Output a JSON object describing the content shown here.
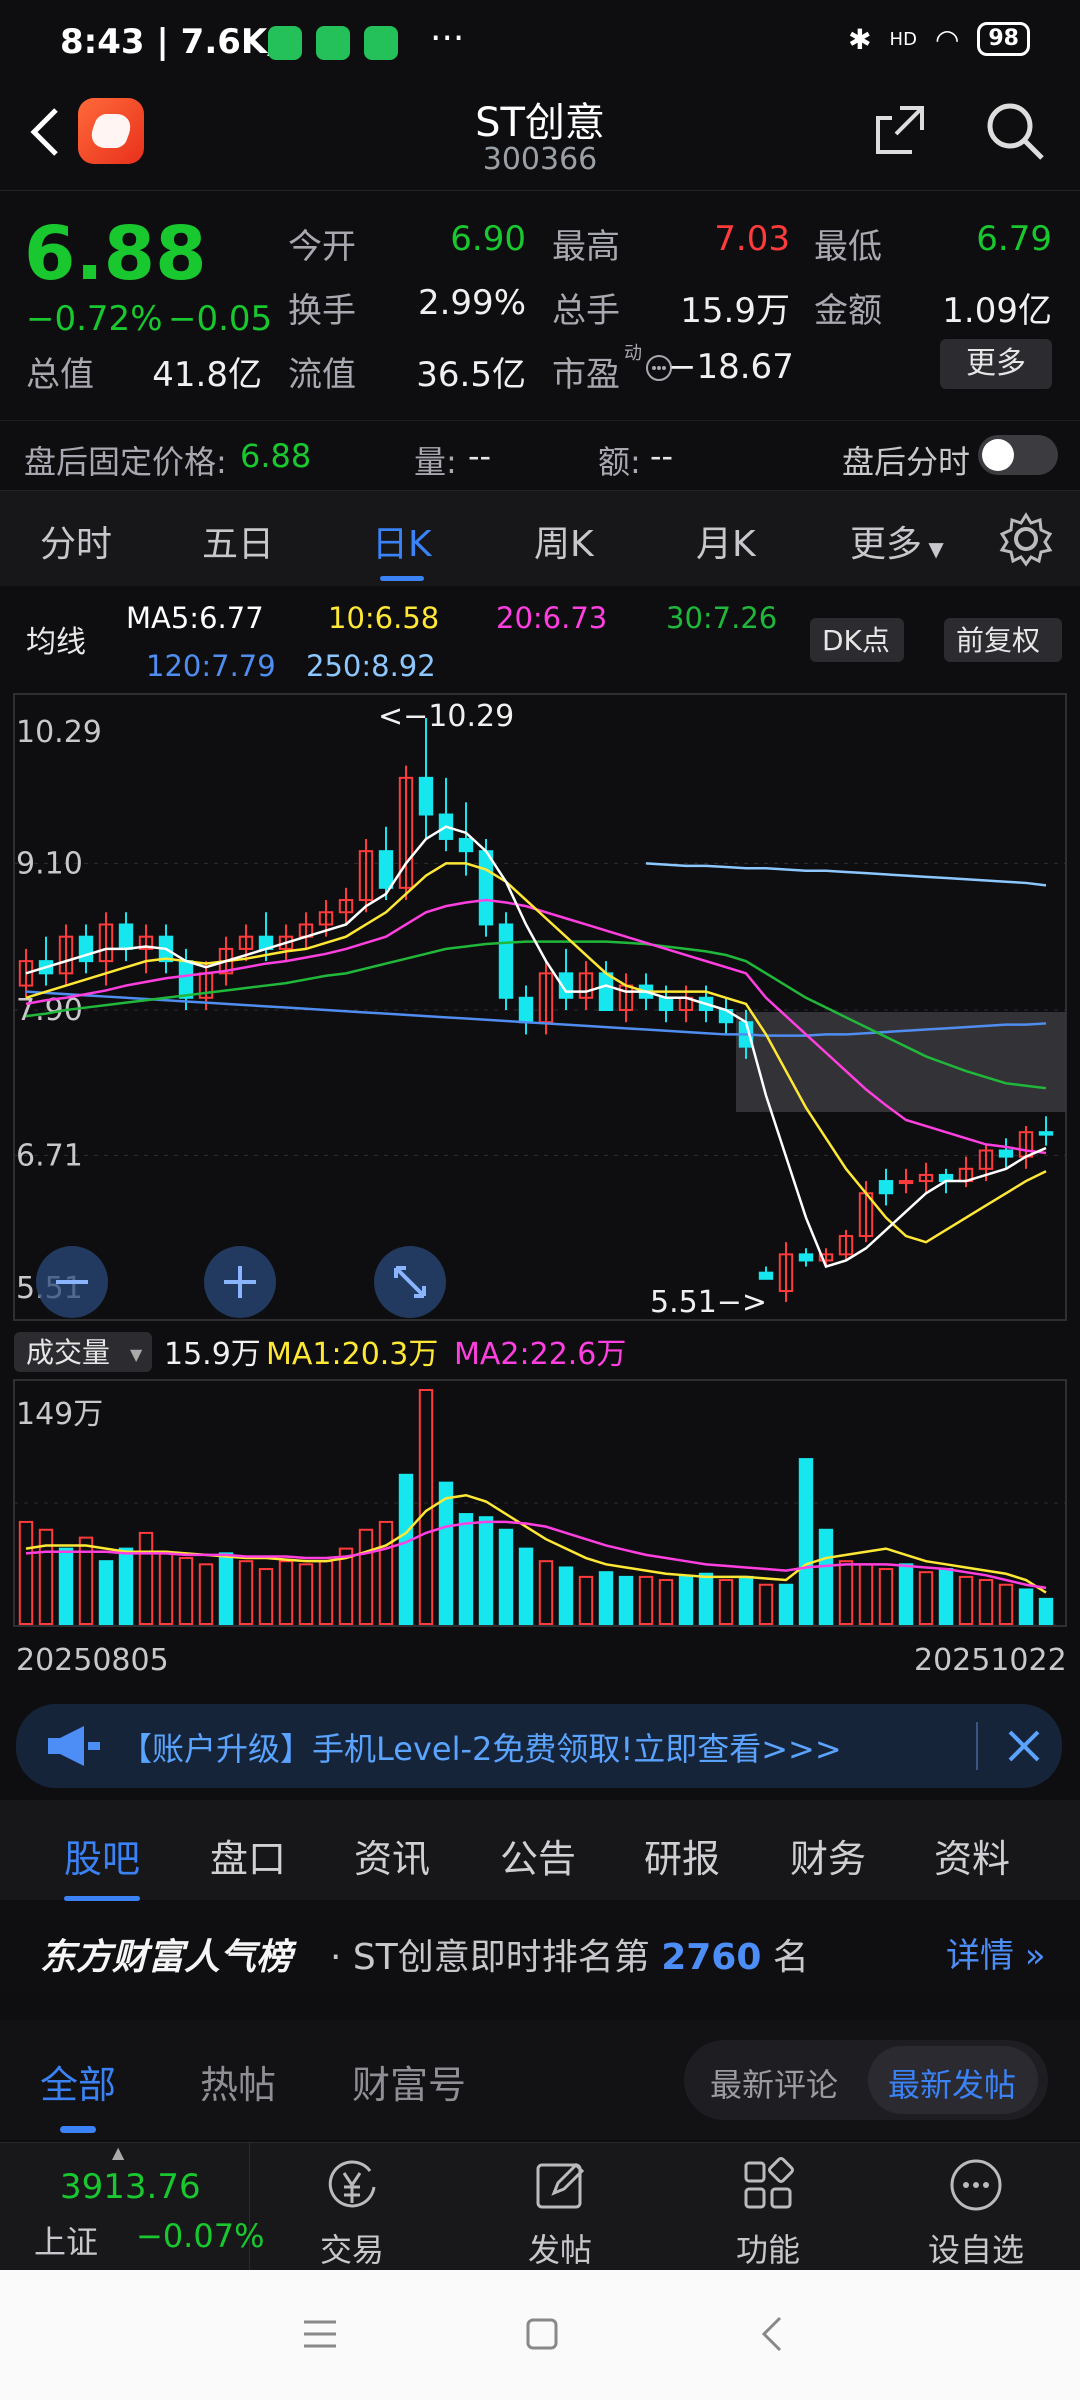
{
  "status": {
    "time": "8:43 | 7.6K/s",
    "more": "···",
    "battery": "98",
    "hd": "HD"
  },
  "header": {
    "title": "ST创意",
    "code": "300366"
  },
  "quote": {
    "price": "6.88",
    "change_pct": "−0.72%",
    "change": "−0.05",
    "fields": [
      {
        "label": "今开",
        "value": "6.90",
        "color": "g"
      },
      {
        "label": "最高",
        "value": "7.03",
        "color": "r"
      },
      {
        "label": "最低",
        "value": "6.79",
        "color": "g"
      },
      {
        "label": "换手",
        "value": "2.99%",
        "color": "w"
      },
      {
        "label": "总手",
        "value": "15.9万",
        "color": "w"
      },
      {
        "label": "金额",
        "value": "1.09亿",
        "color": "w"
      },
      {
        "label": "总值",
        "value": "41.8亿",
        "color": "w"
      },
      {
        "label": "流值",
        "value": "36.5亿",
        "color": "w"
      },
      {
        "label": "市盈",
        "value": "−18.67",
        "color": "w"
      }
    ],
    "pe_super": "动",
    "more_button": "更多"
  },
  "afterhours": {
    "fixed_label": "盘后固定价格:",
    "fixed_value": "6.88",
    "vol_label": "量:",
    "vol_value": "--",
    "amt_label": "额:",
    "amt_value": "--",
    "toggle_label": "盘后分时",
    "toggle_on": false
  },
  "ktabs": [
    "分时",
    "五日",
    "日K",
    "周K",
    "月K",
    "更多"
  ],
  "ktab_active": 2,
  "ma": {
    "title": "均线",
    "items": [
      {
        "text": "MA5:6.77",
        "color": "#ffffff"
      },
      {
        "text": "10:6.58",
        "color": "#ffe835"
      },
      {
        "text": "20:6.73",
        "color": "#ff3fe0"
      },
      {
        "text": "30:7.26",
        "color": "#20b83a"
      },
      {
        "text": "120:7.79",
        "color": "#4f8ef0"
      },
      {
        "text": "250:8.92",
        "color": "#8cc8ff"
      }
    ],
    "dk_button": "DK点",
    "adjust_button": "前复权"
  },
  "chart_data": {
    "type": "candlestick",
    "y_ticks": [
      "10.29",
      "9.10",
      "7.90",
      "6.71",
      "5.51"
    ],
    "ylim": [
      5.51,
      10.29
    ],
    "high_marker": "<−10.29",
    "low_marker": "5.51−>",
    "x_start": "20250805",
    "x_end": "20251022",
    "candles": [
      [
        8.1,
        8.4,
        8.0,
        8.3,
        1
      ],
      [
        8.3,
        8.5,
        8.1,
        8.2,
        0
      ],
      [
        8.2,
        8.6,
        8.1,
        8.5,
        1
      ],
      [
        8.5,
        8.6,
        8.2,
        8.3,
        0
      ],
      [
        8.3,
        8.7,
        8.1,
        8.6,
        1
      ],
      [
        8.6,
        8.7,
        8.3,
        8.4,
        0
      ],
      [
        8.4,
        8.6,
        8.2,
        8.5,
        1
      ],
      [
        8.5,
        8.6,
        8.2,
        8.3,
        0
      ],
      [
        8.3,
        8.4,
        7.9,
        8.0,
        0
      ],
      [
        8.0,
        8.3,
        7.9,
        8.2,
        1
      ],
      [
        8.2,
        8.5,
        8.1,
        8.4,
        1
      ],
      [
        8.4,
        8.6,
        8.3,
        8.5,
        1
      ],
      [
        8.5,
        8.7,
        8.3,
        8.4,
        0
      ],
      [
        8.4,
        8.6,
        8.3,
        8.5,
        1
      ],
      [
        8.5,
        8.7,
        8.4,
        8.6,
        1
      ],
      [
        8.6,
        8.8,
        8.5,
        8.7,
        1
      ],
      [
        8.7,
        8.9,
        8.6,
        8.8,
        1
      ],
      [
        8.8,
        9.3,
        8.7,
        9.2,
        1
      ],
      [
        9.2,
        9.4,
        8.8,
        8.9,
        0
      ],
      [
        8.9,
        9.9,
        8.8,
        9.8,
        1
      ],
      [
        9.8,
        10.29,
        9.3,
        9.5,
        0
      ],
      [
        9.5,
        9.8,
        9.2,
        9.3,
        0
      ],
      [
        9.3,
        9.6,
        9.0,
        9.2,
        0
      ],
      [
        9.2,
        9.3,
        8.5,
        8.6,
        0
      ],
      [
        8.6,
        8.7,
        7.9,
        8.0,
        0
      ],
      [
        8.0,
        8.1,
        7.7,
        7.8,
        0
      ],
      [
        7.8,
        8.3,
        7.7,
        8.2,
        1
      ],
      [
        8.2,
        8.4,
        7.9,
        8.0,
        0
      ],
      [
        8.0,
        8.3,
        7.9,
        8.2,
        1
      ],
      [
        8.2,
        8.3,
        7.9,
        7.9,
        0
      ],
      [
        7.9,
        8.2,
        7.8,
        8.1,
        1
      ],
      [
        8.1,
        8.2,
        7.9,
        8.0,
        0
      ],
      [
        8.0,
        8.1,
        7.8,
        7.9,
        0
      ],
      [
        7.9,
        8.1,
        7.8,
        8.0,
        1
      ],
      [
        8.0,
        8.1,
        7.8,
        7.9,
        0
      ],
      [
        7.9,
        8.0,
        7.7,
        7.8,
        0
      ],
      [
        7.8,
        7.9,
        7.5,
        7.6,
        0
      ],
      [
        5.7,
        5.8,
        5.7,
        5.75,
        0
      ],
      [
        5.6,
        6.0,
        5.51,
        5.9,
        1
      ],
      [
        5.9,
        5.95,
        5.8,
        5.85,
        0
      ],
      [
        5.85,
        5.95,
        5.8,
        5.9,
        1
      ],
      [
        5.9,
        6.1,
        5.85,
        6.05,
        1
      ],
      [
        6.05,
        6.5,
        6.0,
        6.4,
        1
      ],
      [
        6.4,
        6.6,
        6.3,
        6.5,
        0
      ],
      [
        6.5,
        6.6,
        6.4,
        6.5,
        1
      ],
      [
        6.5,
        6.65,
        6.4,
        6.55,
        1
      ],
      [
        6.55,
        6.6,
        6.4,
        6.5,
        0
      ],
      [
        6.5,
        6.7,
        6.45,
        6.6,
        1
      ],
      [
        6.6,
        6.8,
        6.5,
        6.75,
        1
      ],
      [
        6.75,
        6.85,
        6.6,
        6.7,
        0
      ],
      [
        6.7,
        6.95,
        6.6,
        6.9,
        1
      ],
      [
        6.9,
        7.03,
        6.79,
        6.88,
        0
      ]
    ],
    "ma5": [
      8.2,
      8.25,
      8.3,
      8.35,
      8.4,
      8.4,
      8.42,
      8.4,
      8.3,
      8.25,
      8.3,
      8.35,
      8.4,
      8.45,
      8.5,
      8.55,
      8.6,
      8.75,
      8.85,
      9.1,
      9.3,
      9.4,
      9.35,
      9.2,
      8.95,
      8.6,
      8.3,
      8.05,
      8.05,
      8.1,
      8.05,
      8.05,
      8.0,
      8.0,
      7.95,
      7.9,
      7.8,
      7.2,
      6.7,
      6.2,
      5.8,
      5.85,
      5.95,
      6.1,
      6.25,
      6.4,
      6.5,
      6.5,
      6.55,
      6.6,
      6.7,
      6.77
    ],
    "ma10": [
      8.0,
      8.05,
      8.1,
      8.15,
      8.2,
      8.25,
      8.3,
      8.32,
      8.3,
      8.28,
      8.3,
      8.32,
      8.35,
      8.38,
      8.4,
      8.45,
      8.5,
      8.6,
      8.7,
      8.85,
      9.0,
      9.1,
      9.1,
      9.05,
      8.95,
      8.8,
      8.65,
      8.5,
      8.35,
      8.2,
      8.1,
      8.05,
      8.05,
      8.05,
      8.05,
      8.0,
      7.95,
      7.7,
      7.4,
      7.1,
      6.85,
      6.6,
      6.4,
      6.2,
      6.05,
      6.0,
      6.1,
      6.2,
      6.3,
      6.4,
      6.5,
      6.58
    ],
    "ma20": [
      7.95,
      7.98,
      8.0,
      8.03,
      8.06,
      8.1,
      8.13,
      8.16,
      8.18,
      8.2,
      8.22,
      8.25,
      8.28,
      8.3,
      8.33,
      8.36,
      8.4,
      8.45,
      8.5,
      8.6,
      8.7,
      8.75,
      8.78,
      8.8,
      8.78,
      8.75,
      8.7,
      8.65,
      8.6,
      8.55,
      8.5,
      8.45,
      8.4,
      8.35,
      8.3,
      8.25,
      8.2,
      8.0,
      7.85,
      7.7,
      7.55,
      7.4,
      7.25,
      7.12,
      7.0,
      6.95,
      6.9,
      6.85,
      6.8,
      6.78,
      6.75,
      6.73
    ],
    "ma30": [
      7.85,
      7.87,
      7.9,
      7.92,
      7.94,
      7.96,
      7.98,
      8.0,
      8.02,
      8.04,
      8.06,
      8.08,
      8.1,
      8.12,
      8.15,
      8.18,
      8.2,
      8.24,
      8.28,
      8.32,
      8.36,
      8.4,
      8.42,
      8.44,
      8.45,
      8.46,
      8.46,
      8.46,
      8.46,
      8.46,
      8.45,
      8.44,
      8.42,
      8.4,
      8.38,
      8.35,
      8.3,
      8.2,
      8.1,
      8.0,
      7.92,
      7.84,
      7.76,
      7.68,
      7.6,
      7.52,
      7.46,
      7.4,
      7.35,
      7.3,
      7.28,
      7.26
    ],
    "ma120": [
      8.05,
      8.04,
      8.03,
      8.02,
      8.01,
      8.0,
      7.99,
      7.98,
      7.97,
      7.96,
      7.95,
      7.94,
      7.93,
      7.92,
      7.91,
      7.9,
      7.89,
      7.88,
      7.87,
      7.86,
      7.85,
      7.84,
      7.83,
      7.82,
      7.81,
      7.8,
      7.79,
      7.78,
      7.77,
      7.76,
      7.75,
      7.74,
      7.73,
      7.72,
      7.71,
      7.7,
      7.7,
      7.69,
      7.69,
      7.69,
      7.7,
      7.7,
      7.71,
      7.72,
      7.73,
      7.74,
      7.75,
      7.76,
      7.77,
      7.78,
      7.78,
      7.79
    ],
    "ma250_start": 31,
    "ma250": [
      9.1,
      9.09,
      9.08,
      9.08,
      9.07,
      9.06,
      9.06,
      9.05,
      9.04,
      9.04,
      9.03,
      9.02,
      9.01,
      9.0,
      8.99,
      8.98,
      8.97,
      8.96,
      8.95,
      8.94,
      8.92
    ],
    "volume": {
      "label": "成交量",
      "current": "15.9万",
      "ma1": "MA1:20.3万",
      "ma2": "MA2:22.6万",
      "max_label": "149万",
      "max": 149,
      "values": [
        65,
        60,
        48,
        55,
        40,
        48,
        58,
        45,
        42,
        38,
        45,
        40,
        35,
        40,
        38,
        40,
        48,
        60,
        65,
        95,
        149,
        90,
        70,
        68,
        60,
        48,
        40,
        36,
        30,
        33,
        30,
        30,
        28,
        30,
        32,
        28,
        30,
        25,
        25,
        105,
        60,
        40,
        38,
        35,
        38,
        33,
        35,
        30,
        28,
        25,
        22,
        16
      ],
      "colors": [
        1,
        1,
        0,
        1,
        0,
        0,
        1,
        1,
        1,
        1,
        0,
        1,
        1,
        1,
        1,
        1,
        1,
        1,
        1,
        0,
        1,
        0,
        0,
        0,
        0,
        0,
        1,
        0,
        1,
        0,
        0,
        1,
        1,
        0,
        0,
        1,
        0,
        1,
        0,
        0,
        0,
        1,
        1,
        1,
        0,
        1,
        0,
        1,
        1,
        1,
        0,
        0
      ],
      "ma1_values": [
        48,
        50,
        50,
        50,
        48,
        46,
        46,
        46,
        45,
        44,
        43,
        42,
        42,
        41,
        40,
        40,
        42,
        46,
        50,
        58,
        72,
        80,
        82,
        78,
        70,
        62,
        54,
        48,
        42,
        38,
        36,
        34,
        32,
        31,
        30,
        30,
        30,
        29,
        28,
        38,
        42,
        44,
        46,
        48,
        44,
        40,
        38,
        36,
        34,
        32,
        28,
        20
      ],
      "ma2_values": [
        45,
        46,
        46,
        46,
        46,
        45,
        45,
        45,
        44,
        44,
        44,
        43,
        43,
        43,
        42,
        42,
        43,
        45,
        48,
        52,
        58,
        62,
        64,
        65,
        65,
        64,
        62,
        58,
        54,
        50,
        47,
        44,
        42,
        40,
        38,
        37,
        36,
        35,
        34,
        36,
        37,
        38,
        38,
        38,
        37,
        36,
        35,
        33,
        31,
        28,
        25,
        23
      ]
    }
  },
  "banner": {
    "text": "【账户升级】手机Level-2免费领取!立即查看>>>"
  },
  "sectabs": [
    "股吧",
    "盘口",
    "资讯",
    "公告",
    "研报",
    "财务",
    "资料"
  ],
  "rank": {
    "brand": "东方财富人气榜",
    "prefix": "· ST创意即时排名第",
    "number": "2760",
    "suffix": "名",
    "detail": "详情"
  },
  "filter": {
    "tabs": [
      "全部",
      "热帖",
      "财富号"
    ],
    "sort": [
      "最新评论",
      "最新发帖"
    ]
  },
  "index": {
    "value": "3913.76",
    "name": "上证",
    "change": "−0.07%"
  },
  "nav": [
    "交易",
    "发帖",
    "功能",
    "设自选"
  ]
}
